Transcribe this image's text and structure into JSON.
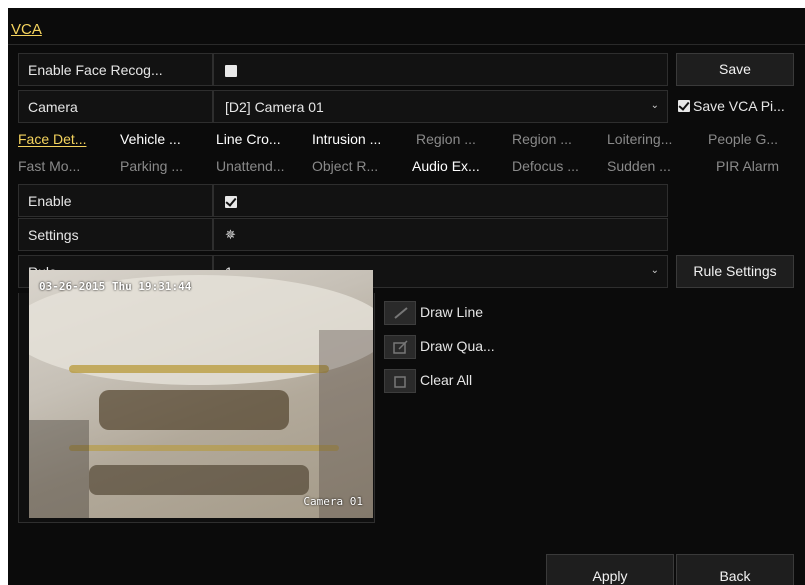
{
  "title": "VCA",
  "rows": {
    "enable_face": {
      "label": "Enable Face Recog...",
      "checked": false
    },
    "camera": {
      "label": "Camera",
      "value": "[D2] Camera 01"
    },
    "enable": {
      "label": "Enable",
      "checked": true
    },
    "settings": {
      "label": "Settings",
      "icon": "gear-icon"
    },
    "rule": {
      "label": "Rule",
      "value": "1"
    }
  },
  "buttons": {
    "save": "Save",
    "save_vca": "Save VCA Pi...",
    "rule_settings": "Rule Settings",
    "apply": "Apply",
    "back": "Back"
  },
  "tabs_row1": [
    "Face Det...",
    "Vehicle ...",
    "Line Cro...",
    "Intrusion ...",
    "Region ...",
    "Region ...",
    "Loitering...",
    "People G..."
  ],
  "tabs_row2": [
    "Fast Mo...",
    "Parking ...",
    "Unattend...",
    "Object R...",
    "Audio Ex...",
    "Defocus ...",
    "Sudden ...",
    "PIR Alarm"
  ],
  "preview": {
    "timestamp": "03-26-2015 Thu 19:31:44",
    "camera_label": "Camera 01"
  },
  "tools": {
    "draw_line": "Draw Line",
    "draw_quad": "Draw Qua...",
    "clear_all": "Clear All"
  },
  "colors": {
    "accent": "#f4d35e",
    "background": "#0b0b0b"
  }
}
